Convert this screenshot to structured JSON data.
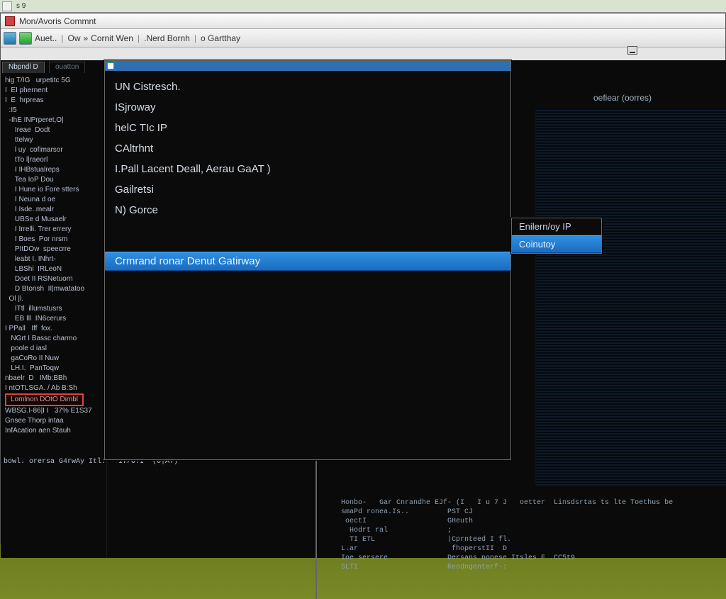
{
  "taskbar": {
    "label": "s  9"
  },
  "window": {
    "title": "Mon/Avoris Commnt",
    "crumbs": [
      "Auet..",
      "Ow",
      "»",
      "Cornit Wen",
      ".Nerd Bornh",
      "o Gartthay"
    ]
  },
  "tree": {
    "tab_active": "Nbpndl D",
    "tab_inactive": "ouatton",
    "lines": [
      "hig T/IG   urpetitc 5G",
      "I  EI phernent",
      "I  E  hrpreas",
      "  :I5",
      "  -IhE INPrperet,O|",
      "     Ireae  Dodt",
      "     ttelwy",
      "     l uy  cofimarsor",
      "     tTo l|raeorl",
      "     I IHBstualreps",
      "     Tea IoP Dou",
      "     I Hune io Fore stters",
      "     I Neuna d oe",
      "     I Isde..mealr",
      "     UBSe d Musaelr",
      "     I Irrelli. Trer errery",
      "     I Boes  Por nrsm",
      "     PItDOw  speecrre",
      "     leabt I. INhrt-",
      "     LBShi  IRLeoN",
      "     Doet II RSNetuorn",
      "     D Btonsh  II|mwatatoo",
      "  Ol |l.",
      "     ITtl  illumstusrs",
      "     EB Ill  IN6cerurs",
      "",
      "I PPall   Iff  fox.",
      "   NGrt I Bassc charmo",
      "   poole d iasl",
      "   gaCoRo II Nuw",
      "   LH.I.  PanToqw",
      "",
      "nbaelr  D   IMb:BBh",
      "I ntOTLSGA. / Ab B:Sh"
    ],
    "red_label": "Lomlnon DOtO Dimbl",
    "tail": [
      "WBSG.I-86|I I   37% E1S37",
      "Gnsee Thorp intaa",
      "InfAcation aen Stauh"
    ]
  },
  "stripe_title": "oefiear (oorres)",
  "popup": {
    "items": [
      "UN Cistresch.",
      "ISjroway",
      "helC TIc IP",
      "CAltrhnt",
      "I.Pall Lacent Deall, Aerau GaAT )",
      "Gailretsi",
      "N) Gorce"
    ],
    "selected": "Crmrand ronar Denut Gatirway"
  },
  "side_popup": {
    "header": "Enilern/oy IP",
    "selected": "Coinutoy"
  },
  "console_left": {
    "lines": [
      "bowl. orersa G4rwAy Itl:   I7/O:I  (O|AT)"
    ]
  },
  "console_right": {
    "lines": [
      "Honbo-   Gar Cnrandhe EJf- (I   I u 7 J   oetter  Linsdsrtas ts lte Toethus be",
      "smaPd ronea.Is..         PST CJ",
      " oectI                   GHeuth",
      "  Hodrt ral              ;",
      "  TI ETL                 |Cprnteed I fl.",
      "L.ar                      fhoperstII  D",
      "Ioe sersere              Dersans nonese Itsles F .CC5t9",
      "SLTI                     Reodngenterf-:"
    ]
  }
}
